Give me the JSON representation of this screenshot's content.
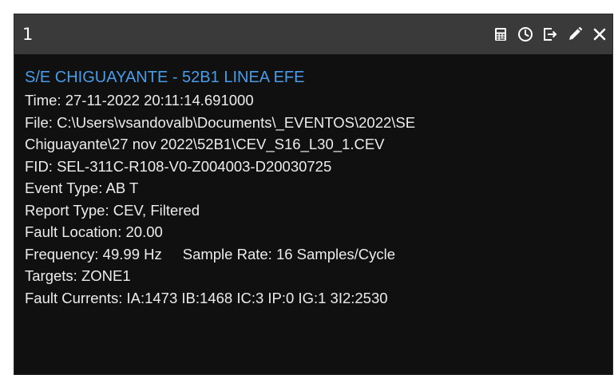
{
  "window": {
    "title": "1",
    "toolbar": {
      "icons": [
        "calculator-icon",
        "clock-icon",
        "export-icon",
        "pencil-icon",
        "close-icon"
      ],
      "close_glyph": "✕"
    }
  },
  "event": {
    "station": "S/E CHIGUAYANTE - 52B1 LINEA EFE",
    "time": "Time:  27-11-2022 20:11:14.691000",
    "file_line1": "File: C:\\Users\\vsandovalb\\Documents\\_EVENTOS\\2022\\SE",
    "file_line2": "Chiguayante\\27 nov 2022\\52B1\\CEV_S16_L30_1.CEV",
    "fid": "FID: SEL-311C-R108-V0-Z004003-D20030725",
    "event_type": "Event Type: AB T",
    "report_type": "Report Type: CEV, Filtered",
    "fault_location": "Fault Location: 20.00",
    "frequency": "Frequency: 49.99 Hz",
    "sample_rate": "Sample Rate: 16 Samples/Cycle",
    "targets": "Targets: ZONE1",
    "fault_currents": "Fault Currents: IA:1473 IB:1468 IC:3 IP:0 IG:1 3I2:2530"
  },
  "colors": {
    "background": "#101010",
    "titlebar": "#3a3a3a",
    "station_text": "#4a9be8",
    "text": "#ececec"
  }
}
